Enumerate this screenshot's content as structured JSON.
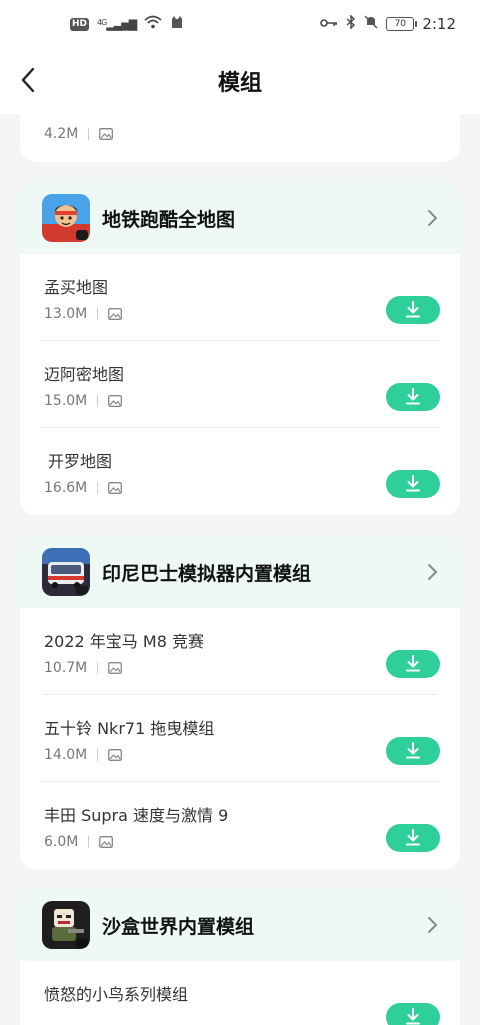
{
  "status_bar": {
    "hd_label": "HD",
    "network_label": "4G",
    "battery": "70",
    "time": "2:12"
  },
  "header": {
    "title": "模组"
  },
  "top_partial": {
    "size": "4.2M"
  },
  "sections": [
    {
      "title": "地铁跑酷全地图",
      "items": [
        {
          "name": "孟买地图",
          "size": "13.0M"
        },
        {
          "name": "迈阿密地图",
          "size": "15.0M"
        },
        {
          "name": "开罗地图",
          "size": "16.6M"
        }
      ]
    },
    {
      "title": "印尼巴士模拟器内置模组",
      "items": [
        {
          "name": "2022 年宝马 M8 竞赛",
          "size": "10.7M"
        },
        {
          "name": "五十铃 Nkr71 拖曳模组",
          "size": "14.0M"
        },
        {
          "name": "丰田 Supra 速度与激情 9",
          "size": "6.0M"
        }
      ]
    },
    {
      "title": "沙盒世界内置模组",
      "items": [
        {
          "name": "愤怒的小鸟系列模组",
          "size": ""
        }
      ]
    }
  ],
  "colors": {
    "accent": "#2fcf99",
    "header_tint": "#eef9f5",
    "background": "#f4f5f7"
  }
}
